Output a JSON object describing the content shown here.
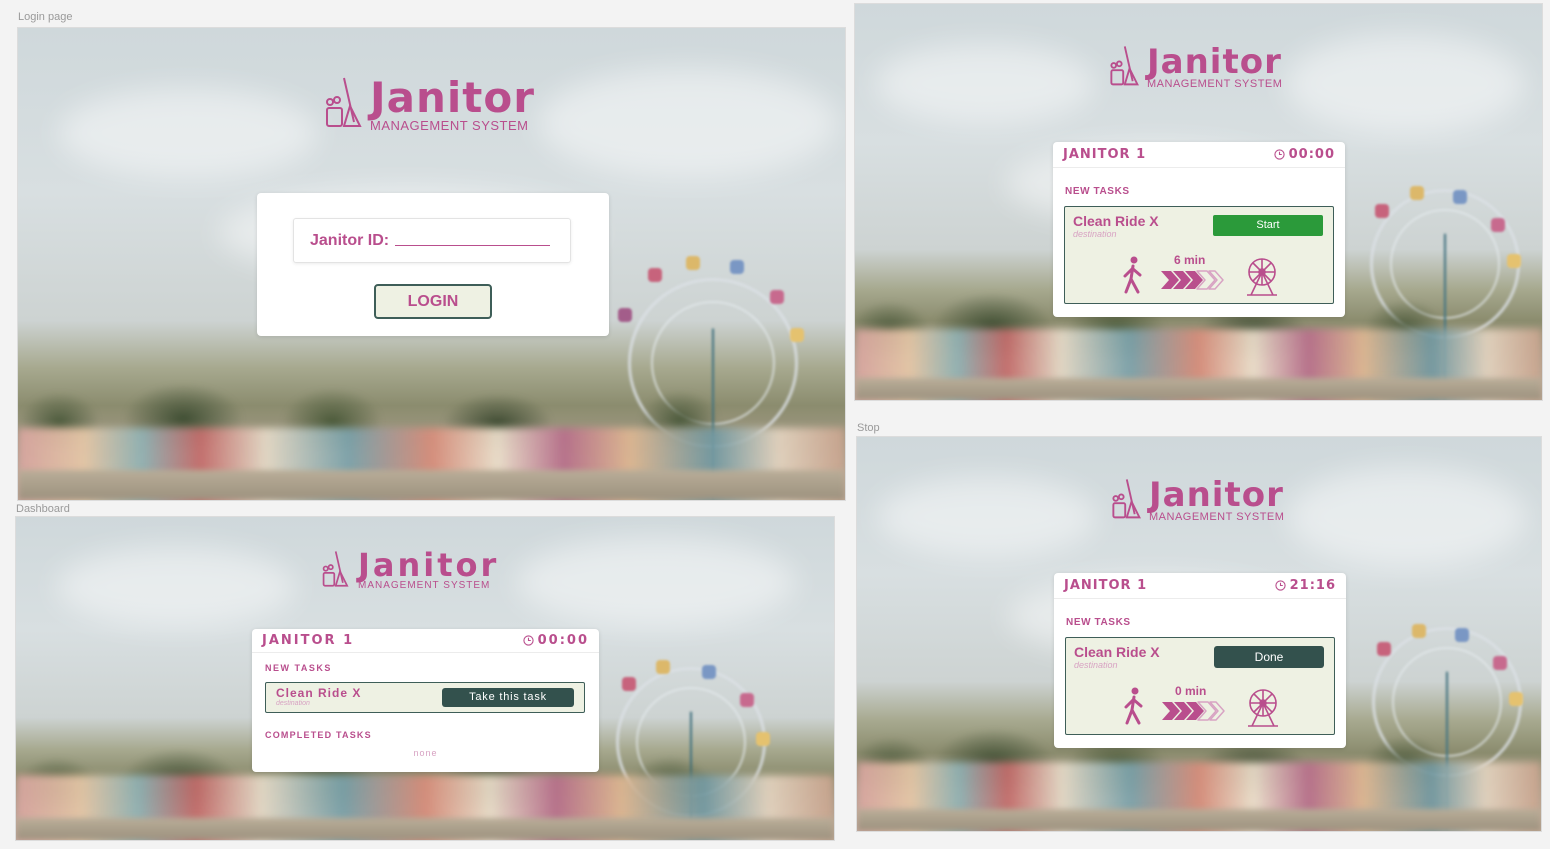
{
  "brand": {
    "title": "Janitor",
    "subtitle": "MANAGEMENT SYSTEM",
    "color": "#b94e8d"
  },
  "frames": {
    "login": {
      "label": "Login page",
      "field_label": "Janitor ID:",
      "login_button": "LOGIN"
    },
    "dashboard": {
      "label": "Dashboard",
      "janitor": "JANITOR 1",
      "timer": "00:00",
      "new_tasks_title": "NEW TASKS",
      "task_name": "Clean Ride X",
      "task_dest": "destination",
      "take_button": "Take this task",
      "completed_title": "COMPLETED TASKS",
      "completed_empty": "none"
    },
    "start": {
      "janitor": "JANITOR 1",
      "timer": "00:00",
      "new_tasks_title": "NEW TASKS",
      "task_name": "Clean Ride X",
      "task_dest": "destination",
      "start_button": "Start",
      "minutes": "6 min"
    },
    "stop": {
      "label": "Stop",
      "janitor": "JANITOR 1",
      "timer": "21:16",
      "new_tasks_title": "NEW TASKS",
      "task_name": "Clean Ride X",
      "task_dest": "destination",
      "done_button": "Done",
      "minutes": "0 min"
    }
  },
  "icons": [
    "janitor-logo-icon",
    "clock-icon",
    "walking-person-icon",
    "progress-chevrons-icon",
    "ferris-wheel-icon"
  ]
}
